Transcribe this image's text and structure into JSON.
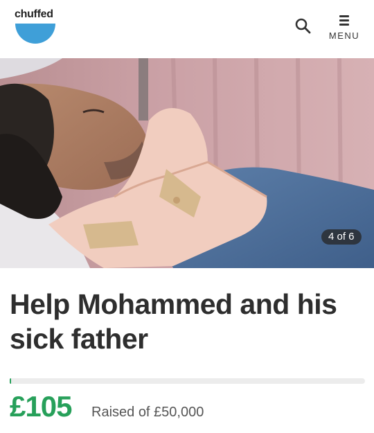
{
  "header": {
    "logo_text": "chuffed",
    "search_icon": "search-icon",
    "menu_icon": "menu-icon",
    "menu_label": "MENU"
  },
  "gallery": {
    "counter": "4 of 6"
  },
  "campaign": {
    "title": "Help Mohammed and his sick father",
    "raised": "£105",
    "raised_of": "Raised of £50,000",
    "progress_fraction": 0.0021
  },
  "colors": {
    "brand_blue": "#3f9fd8",
    "accent_green": "#27a05a"
  }
}
